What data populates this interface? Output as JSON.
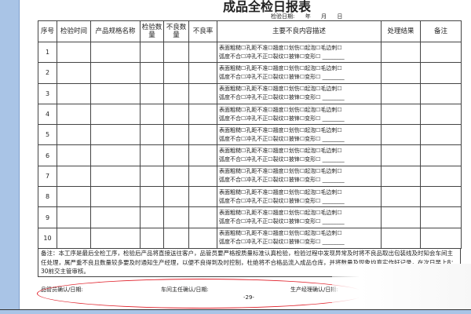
{
  "title": "成品全检日报表",
  "date_line": "检验日期:      年      月      日",
  "headers": [
    "序号",
    "检验时间",
    "产品规格名称",
    "检验数量",
    "不良数量",
    "不良率",
    "主要不良内容描述",
    "处理结果",
    "备注"
  ],
  "rows": [
    {
      "no": "1"
    },
    {
      "no": "2"
    },
    {
      "no": "3"
    },
    {
      "no": "4"
    },
    {
      "no": "5"
    },
    {
      "no": "6"
    },
    {
      "no": "7"
    },
    {
      "no": "8"
    },
    {
      "no": "9"
    },
    {
      "no": "10"
    }
  ],
  "defect_line1": "表面粗糙☐孔距不准☐翘度☐划伤☐起泡☐毛边刺☐",
  "defect_line2": "弧度不合☐冲孔不正☐裂纹☐披锋☐变形☐ ________",
  "notes": "备注：本工序是最后全检工序，检验后产品将直接送往客户，品管员要严格按质量标准认真检验，检验过程中发现异常及时将不良品取出包装线及时知会车间主任处理，属严重不良且数量较多要及时通知生产经理，以便不良得到及时控制，杜绝将不合格品流入成品仓库，并将数量及现象均真实作好记录，在次日早上8：30前交主管审核。",
  "signatures": {
    "qc": "品管员确认/日期:",
    "workshop": "车间主任确认/日期:",
    "production": "生产经理确认/日期:"
  },
  "page_number": "-29-"
}
